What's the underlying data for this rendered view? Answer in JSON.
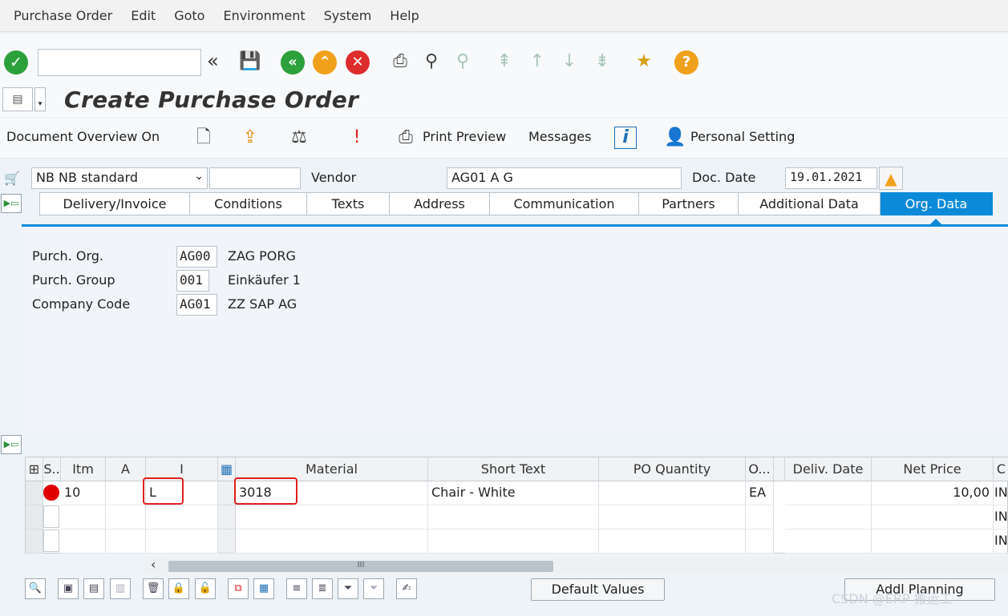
{
  "menu": [
    "Purchase Order",
    "Edit",
    "Goto",
    "Environment",
    "System",
    "Help"
  ],
  "toolbar": {
    "command_value": "",
    "icons": [
      "enter-icon",
      "save-icon",
      "back-icon",
      "exit-icon",
      "cancel-icon",
      "print-icon",
      "find-icon",
      "find-next-icon",
      "first-page-icon",
      "previous-page-icon",
      "next-page-icon",
      "last-page-icon",
      "create-shortcut-icon",
      "help-icon"
    ]
  },
  "title": "Create Purchase Order",
  "app_toolbar": {
    "doc_overview": "Document Overview On",
    "print_preview": "Print Preview",
    "messages": "Messages",
    "personal_setting": "Personal Setting"
  },
  "header": {
    "doc_type": "NB  NB standard",
    "doc_type_extra": "",
    "vendor_label": "Vendor",
    "vendor_value": "AG01 A G",
    "doc_date_label": "Doc. Date",
    "doc_date_value": "19.01.2021"
  },
  "tabs": [
    {
      "label": "Delivery/Invoice",
      "active": false
    },
    {
      "label": "Conditions",
      "active": false
    },
    {
      "label": "Texts",
      "active": false
    },
    {
      "label": "Address",
      "active": false
    },
    {
      "label": "Communication",
      "active": false
    },
    {
      "label": "Partners",
      "active": false
    },
    {
      "label": "Additional Data",
      "active": false
    },
    {
      "label": "Org. Data",
      "active": true
    }
  ],
  "org_data": [
    {
      "label": "Purch. Org.",
      "code": "AG00",
      "desc": "ZAG PORG"
    },
    {
      "label": "Purch. Group",
      "code": "001",
      "desc": "Einkäufer 1"
    },
    {
      "label": "Company Code",
      "code": "AG01",
      "desc": "ZZ SAP AG"
    }
  ],
  "grid": {
    "columns": [
      "S..",
      "Itm",
      "A",
      "I",
      "",
      "Material",
      "Short Text",
      "PO Quantity",
      "O...",
      "Deliv. Date",
      "Net Price",
      "C"
    ],
    "rows": [
      {
        "itm": "10",
        "a": "",
        "i": "L",
        "material": "3018",
        "short_text": "Chair - White",
        "qty": "",
        "unit": "EA",
        "deliv": "",
        "price": "10,00",
        "curr": "IN"
      },
      {
        "itm": "",
        "a": "",
        "i": "",
        "material": "",
        "short_text": "",
        "qty": "",
        "unit": "",
        "deliv": "",
        "price": "",
        "curr": "IN"
      },
      {
        "itm": "",
        "a": "",
        "i": "",
        "material": "",
        "short_text": "",
        "qty": "",
        "unit": "",
        "deliv": "",
        "price": "",
        "curr": "IN"
      }
    ],
    "scroll_thumb": "III"
  },
  "bottom": {
    "default_values": "Default Values",
    "addl_planning": "Addl Planning"
  },
  "watermark": "CSDN @ERP 搬运工",
  "colors": {
    "accent": "#0a8ad8",
    "highlight": "#e02020",
    "ok": "#2ca03a"
  }
}
